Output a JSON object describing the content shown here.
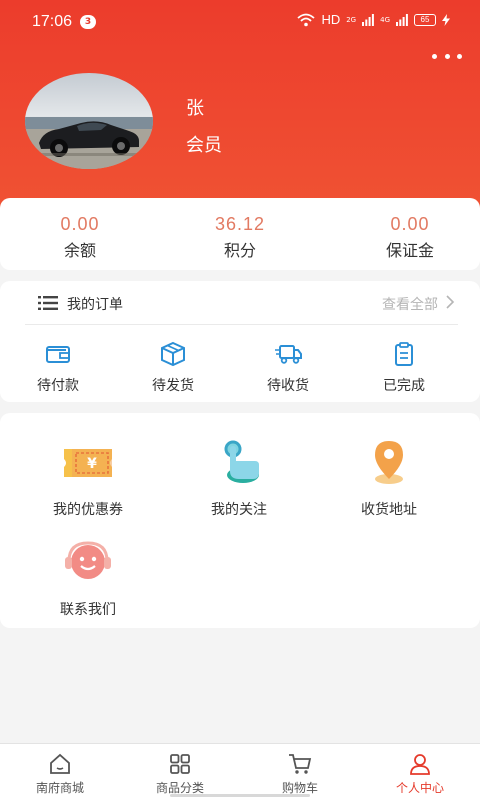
{
  "status_bar": {
    "time": "17:06",
    "notification_count": "3",
    "network": "HD",
    "signal_1": "2G",
    "signal_2": "4G",
    "battery": "65"
  },
  "profile": {
    "name": "张",
    "level": "会员"
  },
  "stats": [
    {
      "value": "0.00",
      "label": "余额"
    },
    {
      "value": "36.12",
      "label": "积分"
    },
    {
      "value": "0.00",
      "label": "保证金"
    }
  ],
  "orders": {
    "title": "我的订单",
    "view_all": "查看全部",
    "items": [
      {
        "label": "待付款",
        "icon": "wallet-icon"
      },
      {
        "label": "待发货",
        "icon": "package-icon"
      },
      {
        "label": "待收货",
        "icon": "truck-icon"
      },
      {
        "label": "已完成",
        "icon": "clipboard-icon"
      }
    ]
  },
  "services": [
    {
      "label": "我的优惠券",
      "icon": "coupon-icon"
    },
    {
      "label": "我的关注",
      "icon": "pointer-hand-icon"
    },
    {
      "label": "收货地址",
      "icon": "location-pin-icon"
    },
    {
      "label": "联系我们",
      "icon": "customer-service-icon"
    }
  ],
  "tabbar": {
    "tabs": [
      {
        "label": "南府商城",
        "icon": "home-icon"
      },
      {
        "label": "商品分类",
        "icon": "category-grid-icon"
      },
      {
        "label": "购物车",
        "icon": "cart-icon"
      },
      {
        "label": "个人中心",
        "icon": "user-icon"
      }
    ],
    "active_index": 3
  },
  "colors": {
    "header_red": "#ec3c2c",
    "accent_orange": "#e27a62",
    "icon_blue": "#2b8fd6",
    "active_tab": "#e53a2b"
  }
}
